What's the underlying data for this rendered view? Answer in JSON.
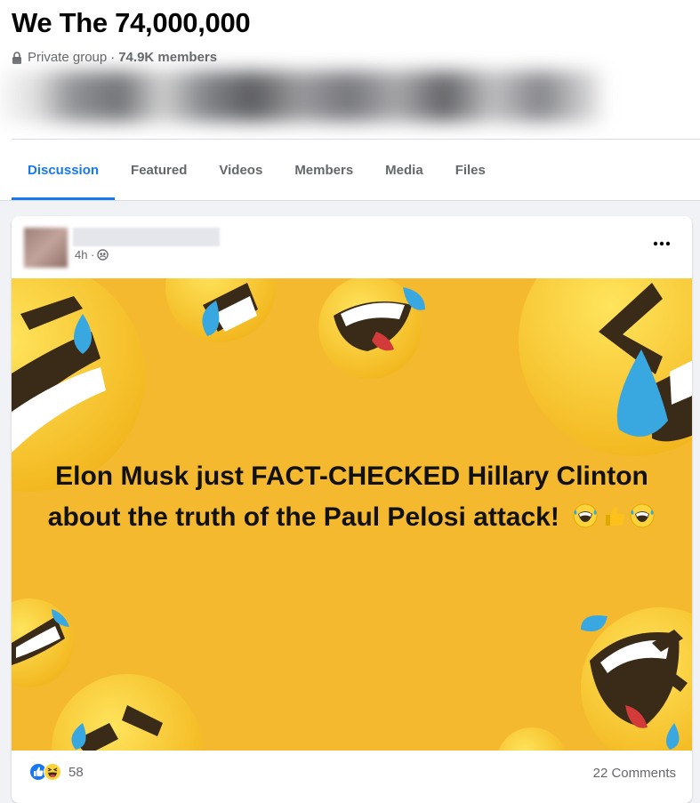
{
  "group": {
    "title": "We The 74,000,000",
    "privacy": "Private group",
    "separator": "·",
    "members": "74.9K members"
  },
  "tabs": [
    {
      "label": "Discussion",
      "active": true
    },
    {
      "label": "Featured",
      "active": false
    },
    {
      "label": "Videos",
      "active": false
    },
    {
      "label": "Members",
      "active": false
    },
    {
      "label": "Media",
      "active": false
    },
    {
      "label": "Files",
      "active": false
    }
  ],
  "post": {
    "time": "4h ·",
    "more_icon": "more-horizontal-icon",
    "privacy_icon": "group-members-icon",
    "image_text": "Elon Musk just FACT-CHECKED Hillary Clinton about the truth of the Paul Pelosi attack!",
    "inline_emojis": [
      "rolling-on-floor-laughing",
      "thumbs-up",
      "rolling-on-floor-laughing"
    ],
    "reaction_count": "58",
    "reaction_icons": [
      "like-icon",
      "haha-icon"
    ],
    "comments": "22 Comments"
  },
  "colors": {
    "accent": "#1877f2",
    "image_background": "#f5b930",
    "emoji_face": "#fcd43a",
    "tear": "#3aa8e0"
  }
}
